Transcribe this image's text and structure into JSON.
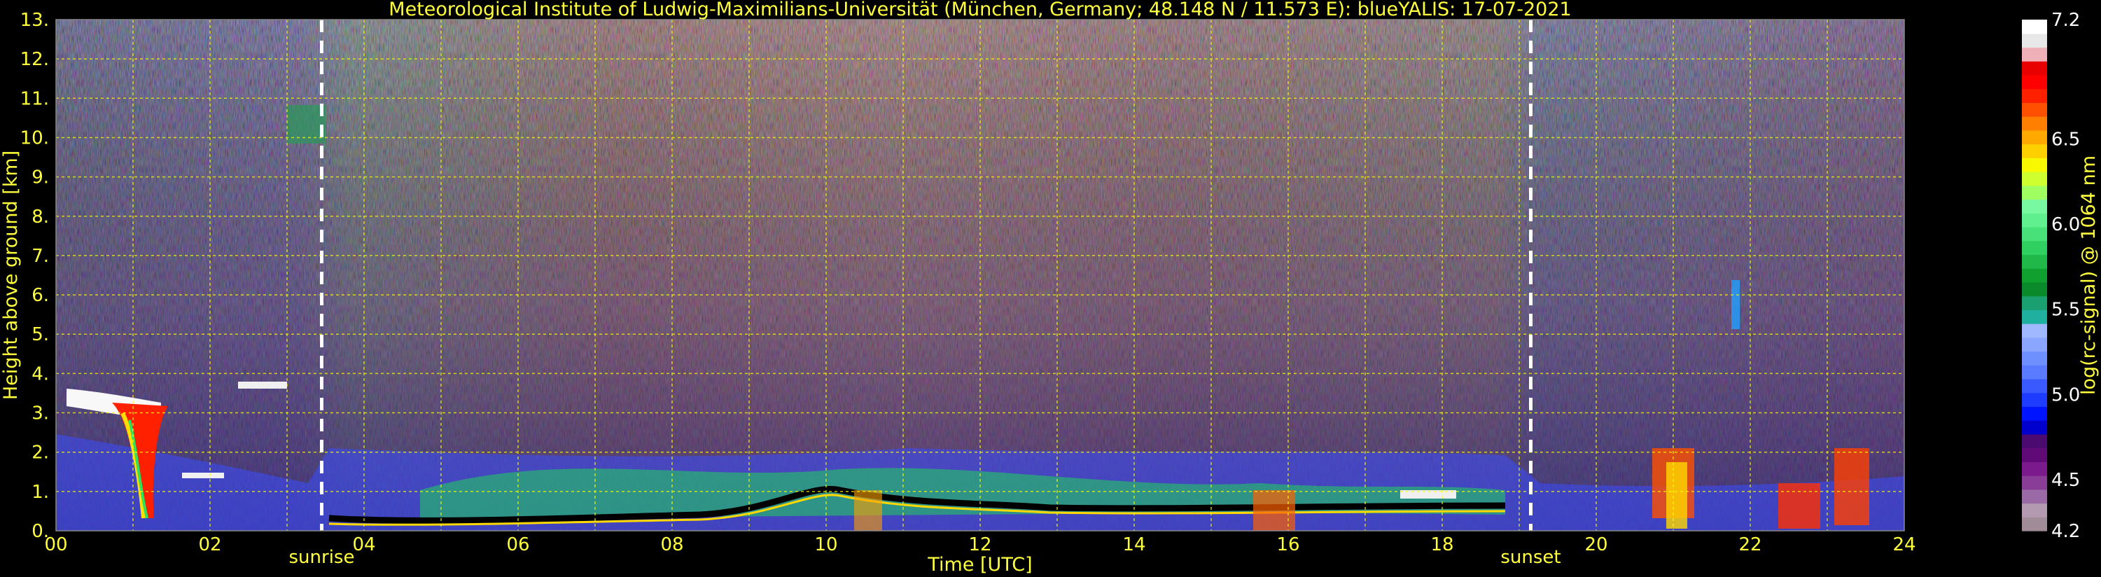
{
  "chart_data": {
    "type": "heatmap",
    "title": "Meteorological Institute of Ludwig-Maximilians-Universität (München, Germany; 48.148 N / 11.573 E):    blueYALIS: 17-07-2021",
    "xlabel": "Time [UTC]",
    "ylabel": "Height above ground [km]",
    "xlim": [
      0,
      24
    ],
    "ylim": [
      0,
      13
    ],
    "x_ticks": [
      "00",
      "02",
      "04",
      "06",
      "08",
      "10",
      "12",
      "14",
      "16",
      "18",
      "20",
      "22",
      "24"
    ],
    "y_ticks": [
      "0.",
      "1.",
      "2.",
      "3.",
      "4.",
      "5.",
      "6.",
      "7.",
      "8.",
      "9.",
      "10.",
      "11.",
      "12.",
      "13."
    ],
    "grid": true,
    "markers": [
      {
        "label": "sunrise",
        "x": 3.45
      },
      {
        "label": "sunset",
        "x": 19.15
      }
    ],
    "colorbar": {
      "label": "log(rc-signal) @ 1064 nm",
      "range": [
        4.2,
        7.2
      ],
      "ticks": [
        "7.2",
        "6.5",
        "6.0",
        "5.5",
        "5.0",
        "4.5",
        "4.2"
      ],
      "tick_values": [
        7.2,
        6.5,
        6.0,
        5.5,
        5.0,
        4.5,
        4.2
      ],
      "colors": [
        "#a08c96",
        "#b49ab0",
        "#9a6aa6",
        "#8a3d96",
        "#7a1a8c",
        "#600a78",
        "#4a0a70",
        "#0000cc",
        "#0014ff",
        "#1e3cff",
        "#3a5aff",
        "#5a7aff",
        "#6e90ff",
        "#8aa6ff",
        "#a0b8ff",
        "#20b0a0",
        "#1aa070",
        "#0a8a2a",
        "#10a030",
        "#20b848",
        "#30d060",
        "#48e078",
        "#60f090",
        "#78f8a0",
        "#a0ff60",
        "#d0ff30",
        "#f8f800",
        "#ffd000",
        "#ffa800",
        "#ff8000",
        "#ff5000",
        "#ff2000",
        "#ff0000",
        "#e80000",
        "#f0b0b8",
        "#e8e8e8",
        "#ffffff"
      ]
    }
  }
}
